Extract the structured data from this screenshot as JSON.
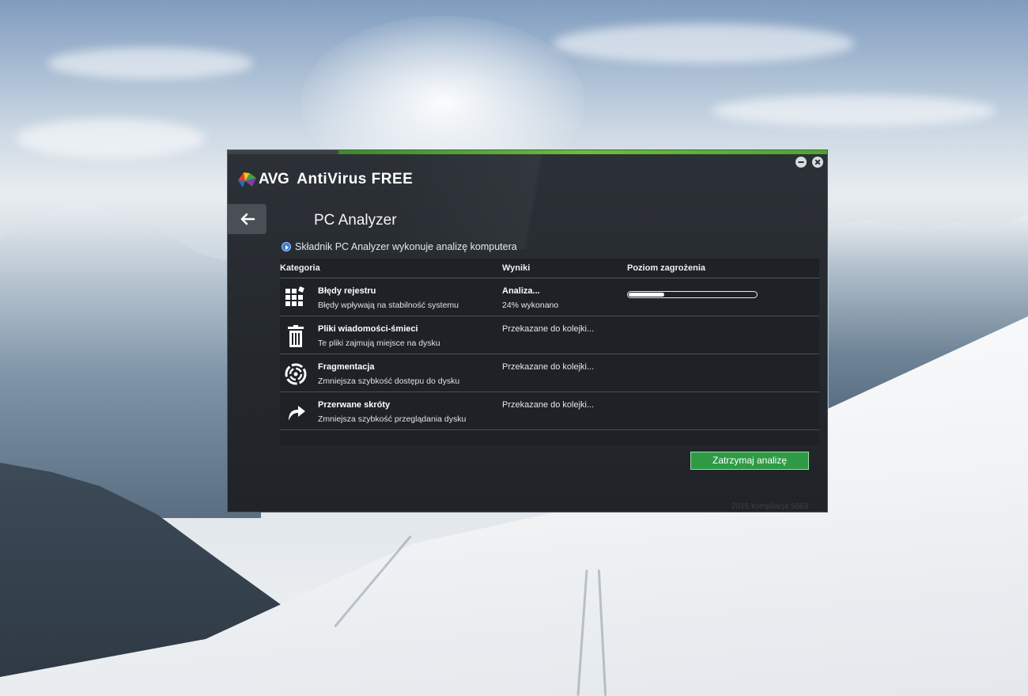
{
  "window": {
    "brand": "AVG",
    "product": "AntiVirus FREE",
    "title": "PC Analyzer",
    "status_message": "Składnik PC Analyzer wykonuje analizę komputera",
    "build_info": "2015  kompilacja 5863",
    "accent_color": "#4ea42f",
    "button_color": "#2f9a45"
  },
  "table": {
    "headers": {
      "category": "Kategoria",
      "results": "Wyniki",
      "threat_level": "Poziom zagrożenia"
    },
    "rows": [
      {
        "icon": "registry-grid-icon",
        "name": "Błędy rejestru",
        "description": "Błędy wpływają na stabilność systemu",
        "result": "Analiza...",
        "result_detail": "24% wykonano",
        "progress": 0.28
      },
      {
        "icon": "trash-icon",
        "name": "Pliki wiadomości-śmieci",
        "description": "Te pliki zajmują miejsce na dysku",
        "result": "Przekazane do kolejki...",
        "result_detail": ""
      },
      {
        "icon": "fragmentation-icon",
        "name": "Fragmentacja",
        "description": "Zmniejsza szybkość dostępu do dysku",
        "result": "Przekazane do kolejki...",
        "result_detail": ""
      },
      {
        "icon": "broken-shortcut-icon",
        "name": "Przerwane skróty",
        "description": "Zmniejsza szybkość przeglądania dysku",
        "result": "Przekazane do kolejki...",
        "result_detail": ""
      }
    ]
  },
  "buttons": {
    "stop": "Zatrzymaj analizę"
  }
}
